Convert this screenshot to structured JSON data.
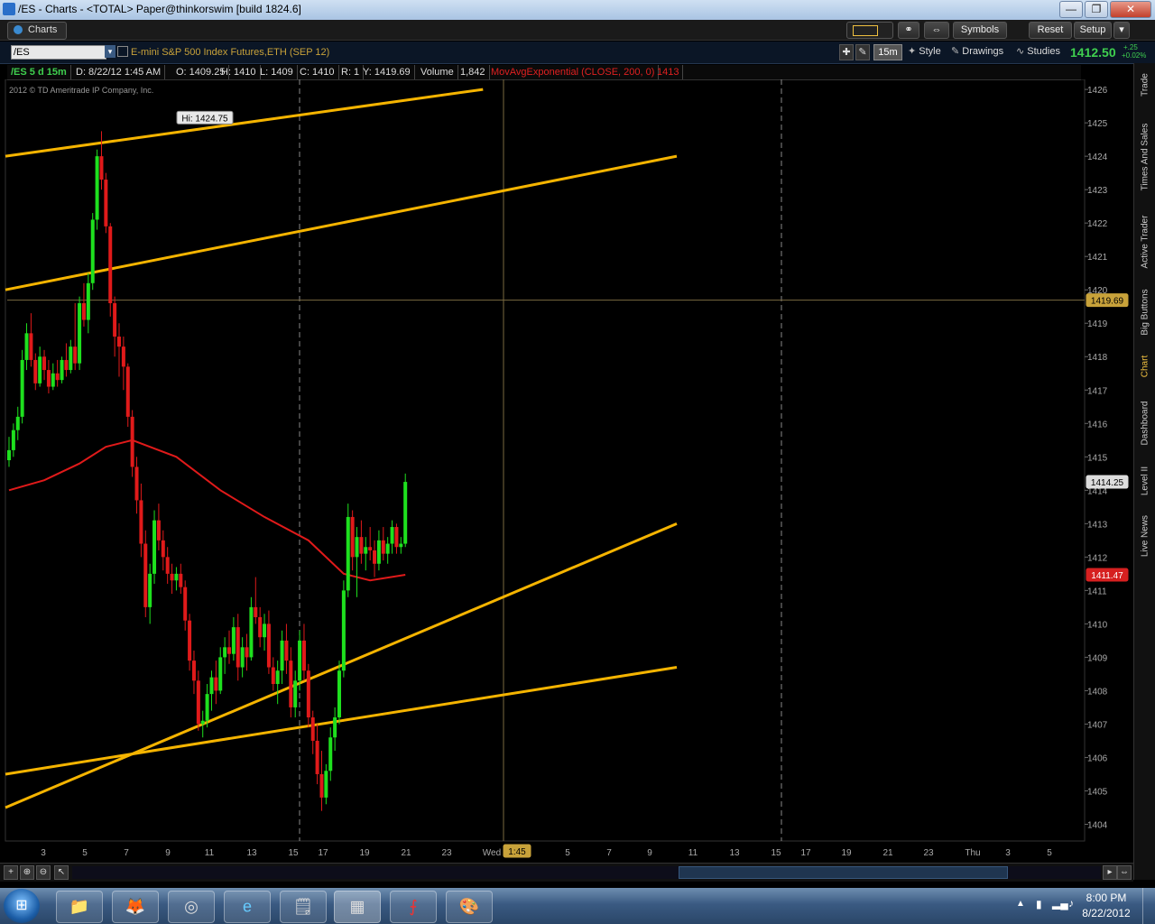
{
  "window": {
    "title": "/ES - Charts - <TOTAL> Paper@thinkorswim [build 1824.6]",
    "controls": {
      "minimize": "—",
      "restore": "❐",
      "close": "✕"
    }
  },
  "toolbar": {
    "tab_label": "Charts",
    "buttons": [
      "Symbols",
      "Reset",
      "Setup"
    ]
  },
  "chart_header": {
    "symbol": "/ES",
    "description": "E-mini S&P 500 Index Futures,ETH (SEP 12)",
    "interval": "15m",
    "style_label": "Style",
    "drawings_label": "Drawings",
    "studies_label": "Studies",
    "last_price": "1412.50",
    "change": "+.25",
    "change_pct": "+0.02%"
  },
  "info_bar": {
    "symbol_period": "/ES 5 d 15m",
    "date": "D: 8/22/12 1:45 AM",
    "open": "O: 1409.25",
    "high": "H: 1410",
    "low": "L: 1409",
    "close": "C: 1410",
    "range": "R: 1",
    "y": "Y: 1419.69",
    "volume_label": "Volume",
    "volume": "1,842",
    "study": "MovAvgExponential (CLOSE, 200, 0)",
    "study_value": "1413"
  },
  "copyright": "2012 © TD Ameritrade IP Company, Inc.",
  "right_tabs": [
    "Trade",
    "Times And Sales",
    "Active Trader",
    "Big Buttons",
    "Chart",
    "Dashboard",
    "Level II",
    "Live News"
  ],
  "right_tabs_active": "Chart",
  "clock": {
    "time": "8:00 PM",
    "date": "8/22/2012"
  },
  "colors": {
    "bull": "#1ee01e",
    "bear": "#e01a1a",
    "ema": "#e01a1a",
    "trendline": "#f5b400",
    "grid": "#7a6a40"
  },
  "chart_data": {
    "type": "candlestick",
    "y_axis_ticks": [
      "1426",
      "1425",
      "1424",
      "1423",
      "1422",
      "1421",
      "1420",
      "1419",
      "1418",
      "1417",
      "1416",
      "1415",
      "1414",
      "1413",
      "1412",
      "1411",
      "1410",
      "1409",
      "1408",
      "1407",
      "1406",
      "1405",
      "1404"
    ],
    "x_axis_ticks": [
      "3",
      "5",
      "7",
      "9",
      "11",
      "13",
      "15",
      "17",
      "19",
      "21",
      "23",
      "Wed",
      "5",
      "7",
      "9",
      "11",
      "13",
      "15",
      "17",
      "19",
      "21",
      "23",
      "Thu",
      "3",
      "5"
    ],
    "crosshair_x_label": "1:45",
    "crosshair_y_label": "1419.69",
    "last_price_label": "1414.25",
    "ema_label": "1411.47",
    "high_label": "Hi: 1424.75",
    "ylim": [
      1403.5,
      1426.3
    ],
    "candles_ohlc": [
      [
        1414.9,
        1415.6,
        1414.7,
        1415.2
      ],
      [
        1415.2,
        1416.0,
        1415.0,
        1415.8
      ],
      [
        1415.8,
        1416.5,
        1415.5,
        1416.2
      ],
      [
        1416.2,
        1418.2,
        1416.0,
        1417.9
      ],
      [
        1417.9,
        1419.0,
        1417.6,
        1418.7
      ],
      [
        1418.7,
        1419.3,
        1417.7,
        1417.9
      ],
      [
        1417.9,
        1418.1,
        1417.0,
        1417.2
      ],
      [
        1417.2,
        1418.3,
        1417.1,
        1418.0
      ],
      [
        1418.0,
        1418.2,
        1417.3,
        1417.6
      ],
      [
        1417.6,
        1417.9,
        1416.9,
        1417.1
      ],
      [
        1417.1,
        1417.8,
        1417.0,
        1417.5
      ],
      [
        1417.5,
        1417.9,
        1417.1,
        1417.3
      ],
      [
        1417.3,
        1418.0,
        1417.2,
        1417.9
      ],
      [
        1417.9,
        1418.4,
        1417.4,
        1417.6
      ],
      [
        1417.6,
        1418.5,
        1417.5,
        1418.3
      ],
      [
        1418.3,
        1419.6,
        1417.6,
        1417.8
      ],
      [
        1417.8,
        1419.8,
        1417.6,
        1419.6
      ],
      [
        1419.6,
        1420.2,
        1418.9,
        1419.1
      ],
      [
        1419.1,
        1420.5,
        1418.7,
        1420.2
      ],
      [
        1420.2,
        1422.3,
        1420.0,
        1422.1
      ],
      [
        1422.1,
        1424.2,
        1421.8,
        1424.0
      ],
      [
        1424.0,
        1424.75,
        1423.0,
        1423.3
      ],
      [
        1423.3,
        1423.5,
        1421.7,
        1421.9
      ],
      [
        1421.9,
        1422.0,
        1419.2,
        1419.6
      ],
      [
        1419.6,
        1419.8,
        1418.0,
        1418.6
      ],
      [
        1418.6,
        1419.0,
        1417.4,
        1418.3
      ],
      [
        1418.3,
        1418.6,
        1417.0,
        1417.7
      ],
      [
        1417.7,
        1417.8,
        1415.9,
        1416.2
      ],
      [
        1416.2,
        1416.4,
        1414.4,
        1414.7
      ],
      [
        1414.7,
        1415.0,
        1413.3,
        1413.7
      ],
      [
        1413.7,
        1414.2,
        1412.0,
        1412.4
      ],
      [
        1412.4,
        1412.8,
        1410.2,
        1410.5
      ],
      [
        1410.5,
        1411.8,
        1410.0,
        1411.5
      ],
      [
        1411.5,
        1413.4,
        1411.2,
        1413.1
      ],
      [
        1413.1,
        1413.6,
        1412.2,
        1412.5
      ],
      [
        1412.5,
        1412.8,
        1411.6,
        1412.0
      ],
      [
        1412.0,
        1412.3,
        1411.2,
        1411.5
      ],
      [
        1411.5,
        1411.8,
        1410.9,
        1411.3
      ],
      [
        1411.3,
        1411.7,
        1411.0,
        1411.5
      ],
      [
        1411.5,
        1411.8,
        1410.9,
        1411.1
      ],
      [
        1411.1,
        1411.3,
        1409.8,
        1410.1
      ],
      [
        1410.1,
        1410.3,
        1408.6,
        1408.9
      ],
      [
        1408.9,
        1409.2,
        1407.9,
        1408.3
      ],
      [
        1408.3,
        1408.6,
        1406.8,
        1407.0
      ],
      [
        1407.0,
        1407.4,
        1406.6,
        1407.1
      ],
      [
        1407.1,
        1408.2,
        1406.9,
        1407.9
      ],
      [
        1407.9,
        1408.6,
        1407.4,
        1408.4
      ],
      [
        1408.4,
        1408.9,
        1407.6,
        1408.0
      ],
      [
        1408.0,
        1409.3,
        1407.9,
        1409.0
      ],
      [
        1409.0,
        1409.6,
        1408.5,
        1409.3
      ],
      [
        1409.3,
        1409.8,
        1408.8,
        1409.1
      ],
      [
        1409.1,
        1410.2,
        1408.9,
        1409.9
      ],
      [
        1409.9,
        1410.3,
        1408.3,
        1408.7
      ],
      [
        1408.7,
        1409.6,
        1408.4,
        1409.3
      ],
      [
        1409.3,
        1409.7,
        1408.6,
        1409.0
      ],
      [
        1409.0,
        1410.8,
        1408.9,
        1410.5
      ],
      [
        1410.5,
        1411.4,
        1410.0,
        1410.2
      ],
      [
        1410.2,
        1410.5,
        1409.3,
        1409.6
      ],
      [
        1409.6,
        1410.3,
        1409.2,
        1410.0
      ],
      [
        1410.0,
        1410.4,
        1408.5,
        1408.7
      ],
      [
        1408.7,
        1409.0,
        1408.0,
        1408.2
      ],
      [
        1408.2,
        1408.9,
        1407.6,
        1408.6
      ],
      [
        1408.6,
        1409.8,
        1408.2,
        1409.5
      ],
      [
        1409.5,
        1410.0,
        1408.5,
        1408.9
      ],
      [
        1408.9,
        1409.3,
        1407.2,
        1407.5
      ],
      [
        1407.5,
        1408.6,
        1407.2,
        1408.3
      ],
      [
        1408.3,
        1409.8,
        1408.0,
        1409.5
      ],
      [
        1409.5,
        1410.0,
        1408.3,
        1408.6
      ],
      [
        1408.6,
        1408.8,
        1406.9,
        1407.2
      ],
      [
        1407.2,
        1407.4,
        1406.1,
        1406.5
      ],
      [
        1406.5,
        1407.0,
        1405.2,
        1405.5
      ],
      [
        1405.5,
        1406.2,
        1404.4,
        1404.8
      ],
      [
        1404.8,
        1405.8,
        1404.6,
        1405.6
      ],
      [
        1405.6,
        1406.9,
        1405.3,
        1406.6
      ],
      [
        1406.6,
        1407.5,
        1406.2,
        1407.2
      ],
      [
        1407.2,
        1408.9,
        1407.0,
        1408.6
      ],
      [
        1408.6,
        1411.3,
        1408.4,
        1411.0
      ],
      [
        1411.0,
        1413.6,
        1410.8,
        1413.2
      ],
      [
        1413.2,
        1413.4,
        1411.6,
        1412.0
      ],
      [
        1412.0,
        1412.9,
        1410.8,
        1412.6
      ],
      [
        1412.6,
        1413.1,
        1411.8,
        1412.1
      ],
      [
        1412.1,
        1412.6,
        1411.6,
        1412.3
      ],
      [
        1412.3,
        1412.9,
        1411.9,
        1412.2
      ],
      [
        1412.2,
        1412.5,
        1411.4,
        1411.8
      ],
      [
        1411.8,
        1412.8,
        1411.6,
        1412.5
      ],
      [
        1412.5,
        1412.9,
        1411.9,
        1412.1
      ],
      [
        1412.1,
        1412.6,
        1411.8,
        1412.4
      ],
      [
        1412.4,
        1413.1,
        1412.1,
        1412.9
      ],
      [
        1412.9,
        1413.0,
        1412.1,
        1412.3
      ],
      [
        1412.3,
        1412.6,
        1412.1,
        1412.4
      ],
      [
        1412.4,
        1414.5,
        1412.3,
        1414.25
      ]
    ],
    "ema_200": [
      [
        0,
        1414.0
      ],
      [
        8,
        1414.3
      ],
      [
        16,
        1414.8
      ],
      [
        22,
        1415.3
      ],
      [
        28,
        1415.5
      ],
      [
        38,
        1415.0
      ],
      [
        48,
        1414.0
      ],
      [
        58,
        1413.2
      ],
      [
        68,
        1412.5
      ],
      [
        76,
        1411.5
      ],
      [
        82,
        1411.3
      ],
      [
        90,
        1411.47
      ]
    ],
    "trendlines": [
      {
        "from": [
          0,
          1424.0
        ],
        "to": [
          106,
          1426.0
        ]
      },
      {
        "from": [
          0,
          1420.0
        ],
        "to": [
          150,
          1424.0
        ]
      },
      {
        "from": [
          0,
          1404.5
        ],
        "to": [
          150,
          1413.0
        ]
      },
      {
        "from": [
          0,
          1405.5
        ],
        "to": [
          150,
          1408.7
        ]
      }
    ]
  }
}
